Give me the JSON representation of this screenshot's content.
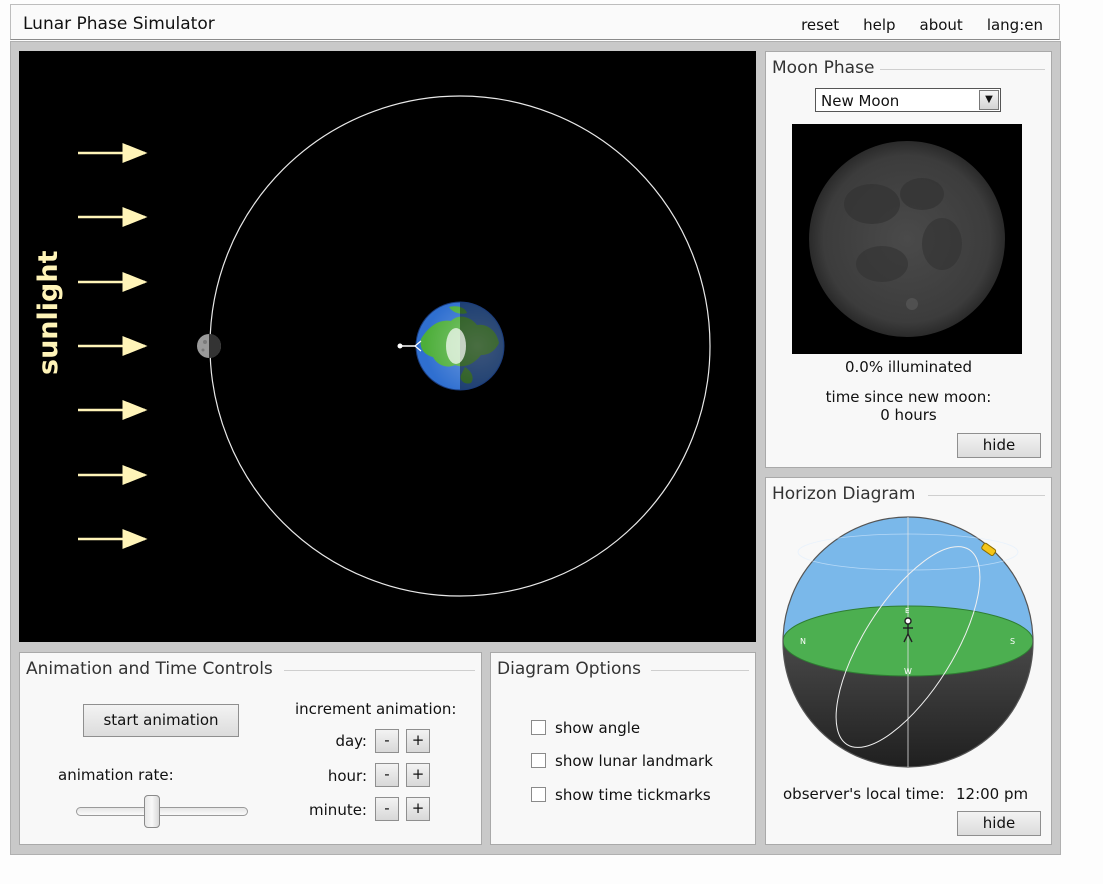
{
  "app": {
    "title": "Lunar Phase Simulator"
  },
  "menu": {
    "reset": "reset",
    "help": "help",
    "about": "about",
    "lang": "lang:en"
  },
  "orbit_view": {
    "sunlight_label": "sunlight",
    "sun_color": "#fff7b0"
  },
  "moon_phase": {
    "title": "Moon Phase",
    "selected_phase": "New Moon",
    "illuminated": "0.0% illuminated",
    "time_since_label": "time since new moon:",
    "time_since_value": "0 hours",
    "hide_label": "hide"
  },
  "horizon": {
    "title": "Horizon Diagram",
    "local_time_label": "observer's local time:",
    "local_time_value": "12:00 pm",
    "hide_label": "hide",
    "sky_color": "#7ab8ea",
    "ground_color": "#4caf50"
  },
  "animation": {
    "title": "Animation and Time Controls",
    "start_label": "start animation",
    "rate_label": "animation rate:",
    "increment_label": "increment animation:",
    "day_label": "day:",
    "hour_label": "hour:",
    "minute_label": "minute:",
    "minus": "-",
    "plus": "+"
  },
  "options": {
    "title": "Diagram Options",
    "show_angle": "show angle",
    "show_landmark": "show lunar landmark",
    "show_tickmarks": "show time tickmarks"
  }
}
